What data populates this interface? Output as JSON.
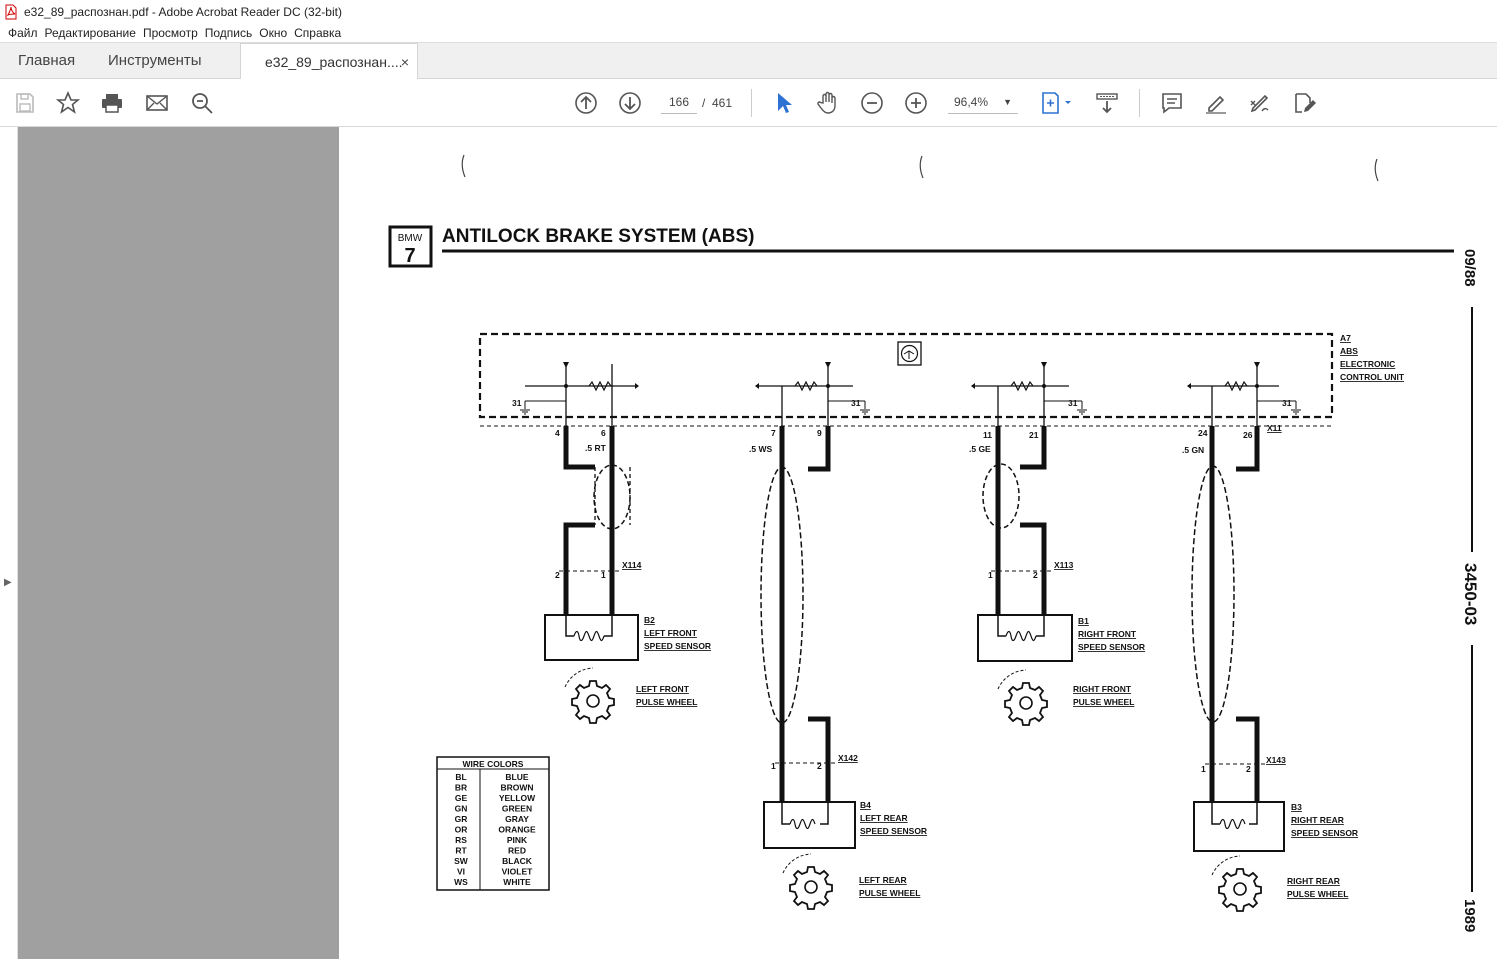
{
  "window": {
    "title": "e32_89_распознан.pdf - Adobe Acrobat Reader DC (32-bit)"
  },
  "menu": [
    "Файл",
    "Редактирование",
    "Просмотр",
    "Подпись",
    "Окно",
    "Справка"
  ],
  "tabs": {
    "home": "Главная",
    "tools": "Инструменты",
    "document": "e32_89_распознан....",
    "close": "×"
  },
  "toolbar": {
    "current_page": "166",
    "page_sep": "/",
    "total_pages": "461",
    "zoom": "96,4%"
  },
  "colors": {
    "accent": "#2d72d2",
    "gray_pane": "#a0a0a0"
  },
  "icons": [
    "save-icon",
    "star-icon",
    "print-icon",
    "mail-icon",
    "search-zoom-icon",
    "page-up-icon",
    "page-down-icon",
    "select-cursor-icon",
    "hand-icon",
    "zoom-out-icon",
    "zoom-in-icon",
    "fit-page-icon",
    "scroll-mode-icon",
    "comment-icon",
    "highlight-icon",
    "sign-icon",
    "edit-pdf-icon"
  ],
  "document": {
    "badge_top": "BMW",
    "badge_num": "7",
    "title": "ANTILOCK BRAKE SYSTEM (ABS)",
    "side_date": "09/88",
    "side_code": "3450-03",
    "side_year": "1989",
    "unit_label": [
      "A7",
      "ABS",
      "ELECTRONIC",
      "CONTROL UNIT"
    ],
    "connector_main": "X11",
    "ground": "31",
    "pins": [
      "4",
      "6",
      "7",
      "9",
      "11",
      "21",
      "24",
      "26"
    ],
    "wires": [
      ".5 RT",
      ".5 WS",
      ".5 GE",
      ".5 GN"
    ],
    "connectors": [
      "X114",
      "X142",
      "X113",
      "X143"
    ],
    "conn_pins": [
      "2",
      "1",
      "1",
      "2",
      "1",
      "2",
      "1",
      "2"
    ],
    "sensors": [
      {
        "id": "B2",
        "l1": "LEFT FRONT",
        "l2": "SPEED SENSOR",
        "w1": "LEFT FRONT",
        "w2": "PULSE WHEEL"
      },
      {
        "id": "B4",
        "l1": "LEFT REAR",
        "l2": "SPEED SENSOR",
        "w1": "LEFT REAR",
        "w2": "PULSE WHEEL"
      },
      {
        "id": "B1",
        "l1": "RIGHT FRONT",
        "l2": "SPEED SENSOR",
        "w1": "RIGHT FRONT",
        "w2": "PULSE WHEEL"
      },
      {
        "id": "B3",
        "l1": "RIGHT REAR",
        "l2": "SPEED SENSOR",
        "w1": "RIGHT REAR",
        "w2": "PULSE WHEEL"
      }
    ],
    "wire_colors_title": "WIRE COLORS",
    "wire_colors": [
      [
        "BL",
        "BLUE"
      ],
      [
        "BR",
        "BROWN"
      ],
      [
        "GE",
        "YELLOW"
      ],
      [
        "GN",
        "GREEN"
      ],
      [
        "GR",
        "GRAY"
      ],
      [
        "OR",
        "ORANGE"
      ],
      [
        "RS",
        "PINK"
      ],
      [
        "RT",
        "RED"
      ],
      [
        "SW",
        "BLACK"
      ],
      [
        "VI",
        "VIOLET"
      ],
      [
        "WS",
        "WHITE"
      ]
    ]
  }
}
